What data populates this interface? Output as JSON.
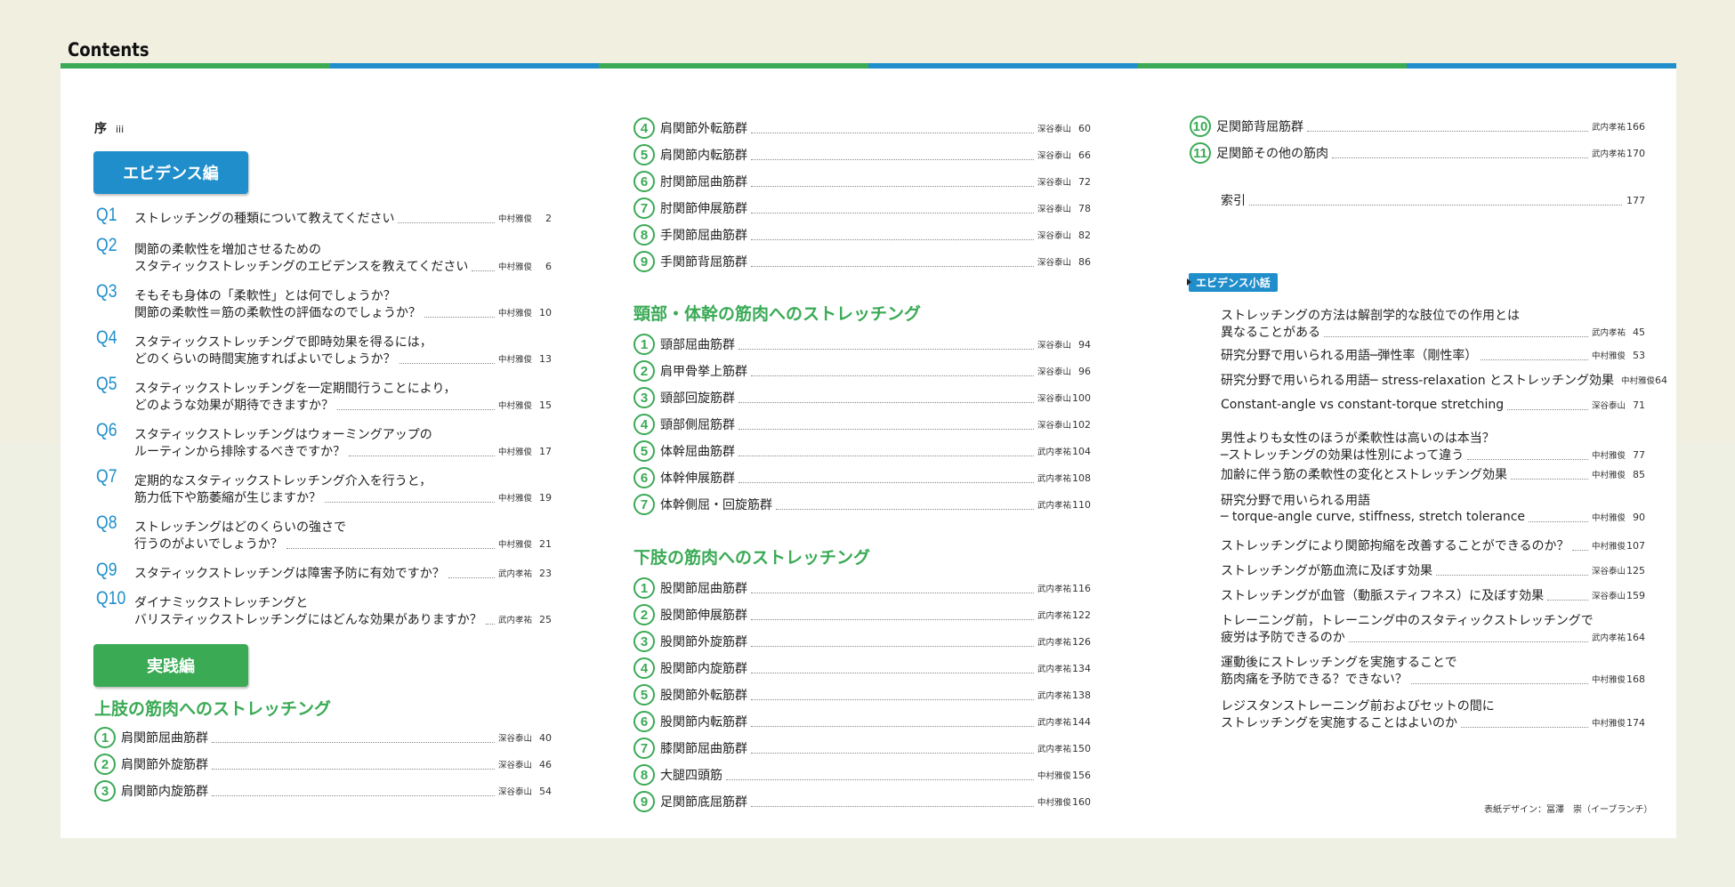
{
  "header": {
    "title": "Contents",
    "stripe_colors": [
      "#3aaa55",
      "#1f8ecb",
      "#3aaa55",
      "#1f8ecb",
      "#3aaa55",
      "#1f8ecb"
    ]
  },
  "colors": {
    "blue": "#1f8ecb",
    "green": "#3aaa55"
  },
  "preface": {
    "label": "序",
    "page": "iii"
  },
  "evidence_button": "エビデンス編",
  "practice_button": "実践編",
  "questions": [
    {
      "q": "Q1",
      "l1": "ストレッチングの種類について教えてください",
      "l2": "",
      "author": "中村雅俊",
      "page": "2"
    },
    {
      "q": "Q2",
      "l1": "関節の柔軟性を増加させるための",
      "l2": "スタティックストレッチングのエビデンスを教えてください",
      "author": "中村雅俊",
      "page": "6"
    },
    {
      "q": "Q3",
      "l1": "そもそも身体の「柔軟性」とは何でしょうか？",
      "l2": "関節の柔軟性＝筋の柔軟性の評価なのでしょうか？",
      "author": "中村雅俊",
      "page": "10"
    },
    {
      "q": "Q4",
      "l1": "スタティックストレッチングで即時効果を得るには，",
      "l2": "どのくらいの時間実施すればよいでしょうか？",
      "author": "中村雅俊",
      "page": "13"
    },
    {
      "q": "Q5",
      "l1": "スタティックストレッチングを一定期間行うことにより，",
      "l2": "どのような効果が期待できますか？",
      "author": "中村雅俊",
      "page": "15"
    },
    {
      "q": "Q6",
      "l1": "スタティックストレッチングはウォーミングアップの",
      "l2": "ルーティンから排除するべきですか？",
      "author": "中村雅俊",
      "page": "17"
    },
    {
      "q": "Q7",
      "l1": "定期的なスタティックストレッチング介入を行うと，",
      "l2": "筋力低下や筋萎縮が生じますか？",
      "author": "中村雅俊",
      "page": "19"
    },
    {
      "q": "Q8",
      "l1": "ストレッチングはどのくらいの強さで",
      "l2": "行うのがよいでしょうか？",
      "author": "中村雅俊",
      "page": "21"
    },
    {
      "q": "Q9",
      "l1": "スタティックストレッチングは障害予防に有効ですか？",
      "l2": "",
      "author": "武内孝祐",
      "page": "23"
    },
    {
      "q": "Q10",
      "l1": "ダイナミックストレッチングと",
      "l2": "バリスティックストレッチングにはどんな効果がありますか？",
      "author": "武内孝祐",
      "page": "25"
    }
  ],
  "upper": {
    "title": "上肢の筋肉へのストレッチング",
    "items": [
      {
        "n": "1",
        "t": "肩関節屈曲筋群",
        "a": "深谷泰山",
        "p": "40"
      },
      {
        "n": "2",
        "t": "肩関節外旋筋群",
        "a": "深谷泰山",
        "p": "46"
      },
      {
        "n": "3",
        "t": "肩関節内旋筋群",
        "a": "深谷泰山",
        "p": "54"
      },
      {
        "n": "4",
        "t": "肩関節外転筋群",
        "a": "深谷泰山",
        "p": "60"
      },
      {
        "n": "5",
        "t": "肩関節内転筋群",
        "a": "深谷泰山",
        "p": "66"
      },
      {
        "n": "6",
        "t": "肘関節屈曲筋群",
        "a": "深谷泰山",
        "p": "72"
      },
      {
        "n": "7",
        "t": "肘関節伸展筋群",
        "a": "深谷泰山",
        "p": "78"
      },
      {
        "n": "8",
        "t": "手関節屈曲筋群",
        "a": "深谷泰山",
        "p": "82"
      },
      {
        "n": "9",
        "t": "手関節背屈筋群",
        "a": "深谷泰山",
        "p": "86"
      }
    ]
  },
  "trunk": {
    "title": "頸部・体幹の筋肉へのストレッチング",
    "items": [
      {
        "n": "1",
        "t": "頸部屈曲筋群",
        "a": "深谷泰山",
        "p": "94"
      },
      {
        "n": "2",
        "t": "肩甲骨挙上筋群",
        "a": "深谷泰山",
        "p": "96"
      },
      {
        "n": "3",
        "t": "頸部回旋筋群",
        "a": "深谷泰山",
        "p": "100"
      },
      {
        "n": "4",
        "t": "頸部側屈筋群",
        "a": "深谷泰山",
        "p": "102"
      },
      {
        "n": "5",
        "t": "体幹屈曲筋群",
        "a": "武内孝祐",
        "p": "104"
      },
      {
        "n": "6",
        "t": "体幹伸展筋群",
        "a": "武内孝祐",
        "p": "108"
      },
      {
        "n": "7",
        "t": "体幹側屈・回旋筋群",
        "a": "武内孝祐",
        "p": "110"
      }
    ]
  },
  "lower": {
    "title": "下肢の筋肉へのストレッチング",
    "items": [
      {
        "n": "1",
        "t": "股関節屈曲筋群",
        "a": "武内孝祐",
        "p": "116"
      },
      {
        "n": "2",
        "t": "股関節伸展筋群",
        "a": "武内孝祐",
        "p": "122"
      },
      {
        "n": "3",
        "t": "股関節外旋筋群",
        "a": "武内孝祐",
        "p": "126"
      },
      {
        "n": "4",
        "t": "股関節内旋筋群",
        "a": "武内孝祐",
        "p": "134"
      },
      {
        "n": "5",
        "t": "股関節外転筋群",
        "a": "武内孝祐",
        "p": "138"
      },
      {
        "n": "6",
        "t": "股関節内転筋群",
        "a": "武内孝祐",
        "p": "144"
      },
      {
        "n": "7",
        "t": "膝関節屈曲筋群",
        "a": "武内孝祐",
        "p": "150"
      },
      {
        "n": "8",
        "t": "大腿四頭筋",
        "a": "中村雅俊",
        "p": "156"
      },
      {
        "n": "9",
        "t": "足関節底屈筋群",
        "a": "中村雅俊",
        "p": "160"
      },
      {
        "n": "10",
        "t": "足関節背屈筋群",
        "a": "武内孝祐",
        "p": "166"
      },
      {
        "n": "11",
        "t": "足関節その他の筋肉",
        "a": "武内孝祐",
        "p": "170"
      }
    ]
  },
  "index": {
    "label": "索引",
    "page": "177"
  },
  "column": {
    "label": "エビデンス小話",
    "items": [
      {
        "l1": "ストレッチングの方法は解剖学的な肢位での作用とは",
        "l2": "異なることがある",
        "a": "武内孝祐",
        "p": "45"
      },
      {
        "l1": "研究分野で用いられる用語─弾性率（剛性率）",
        "l2": "",
        "a": "中村雅俊",
        "p": "53"
      },
      {
        "l1": "研究分野で用いられる用語─ stress-relaxation とストレッチング効果",
        "l2": "",
        "a": "中村雅俊",
        "p": "64"
      },
      {
        "l1": "Constant-angle vs constant-torque stretching",
        "l2": "",
        "a": "深谷泰山",
        "p": "71"
      },
      {
        "l1": "男性よりも女性のほうが柔軟性は高いのは本当？",
        "l2": "─ストレッチングの効果は性別によって違う",
        "a": "中村雅俊",
        "p": "77"
      },
      {
        "l1": "加齢に伴う筋の柔軟性の変化とストレッチング効果",
        "l2": "",
        "a": "中村雅俊",
        "p": "85"
      },
      {
        "l1": "研究分野で用いられる用語",
        "l2": "─ torque-angle curve, stiffness, stretch tolerance",
        "a": "中村雅俊",
        "p": "90"
      },
      {
        "l1": "ストレッチングにより関節拘縮を改善することができるのか？",
        "l2": "",
        "a": "中村雅俊",
        "p": "107"
      },
      {
        "l1": "ストレッチングが筋血流に及ぼす効果",
        "l2": "",
        "a": "深谷泰山",
        "p": "125"
      },
      {
        "l1": "ストレッチングが血管（動脈スティフネス）に及ぼす効果",
        "l2": "",
        "a": "深谷泰山",
        "p": "159"
      },
      {
        "l1": "トレーニング前，トレーニング中のスタティックストレッチングで",
        "l2": "疲労は予防できるのか",
        "a": "武内孝祐",
        "p": "164"
      },
      {
        "l1": "運動後にストレッチングを実施することで",
        "l2": "筋肉痛を予防できる？できない？",
        "a": "中村雅俊",
        "p": "168"
      },
      {
        "l1": "レジスタンストレーニング前およびセットの間に",
        "l2": "ストレッチングを実施することはよいのか",
        "a": "中村雅俊",
        "p": "174"
      }
    ]
  },
  "credit": "表紙デザイン：冨澤　崇（イーブランチ）"
}
